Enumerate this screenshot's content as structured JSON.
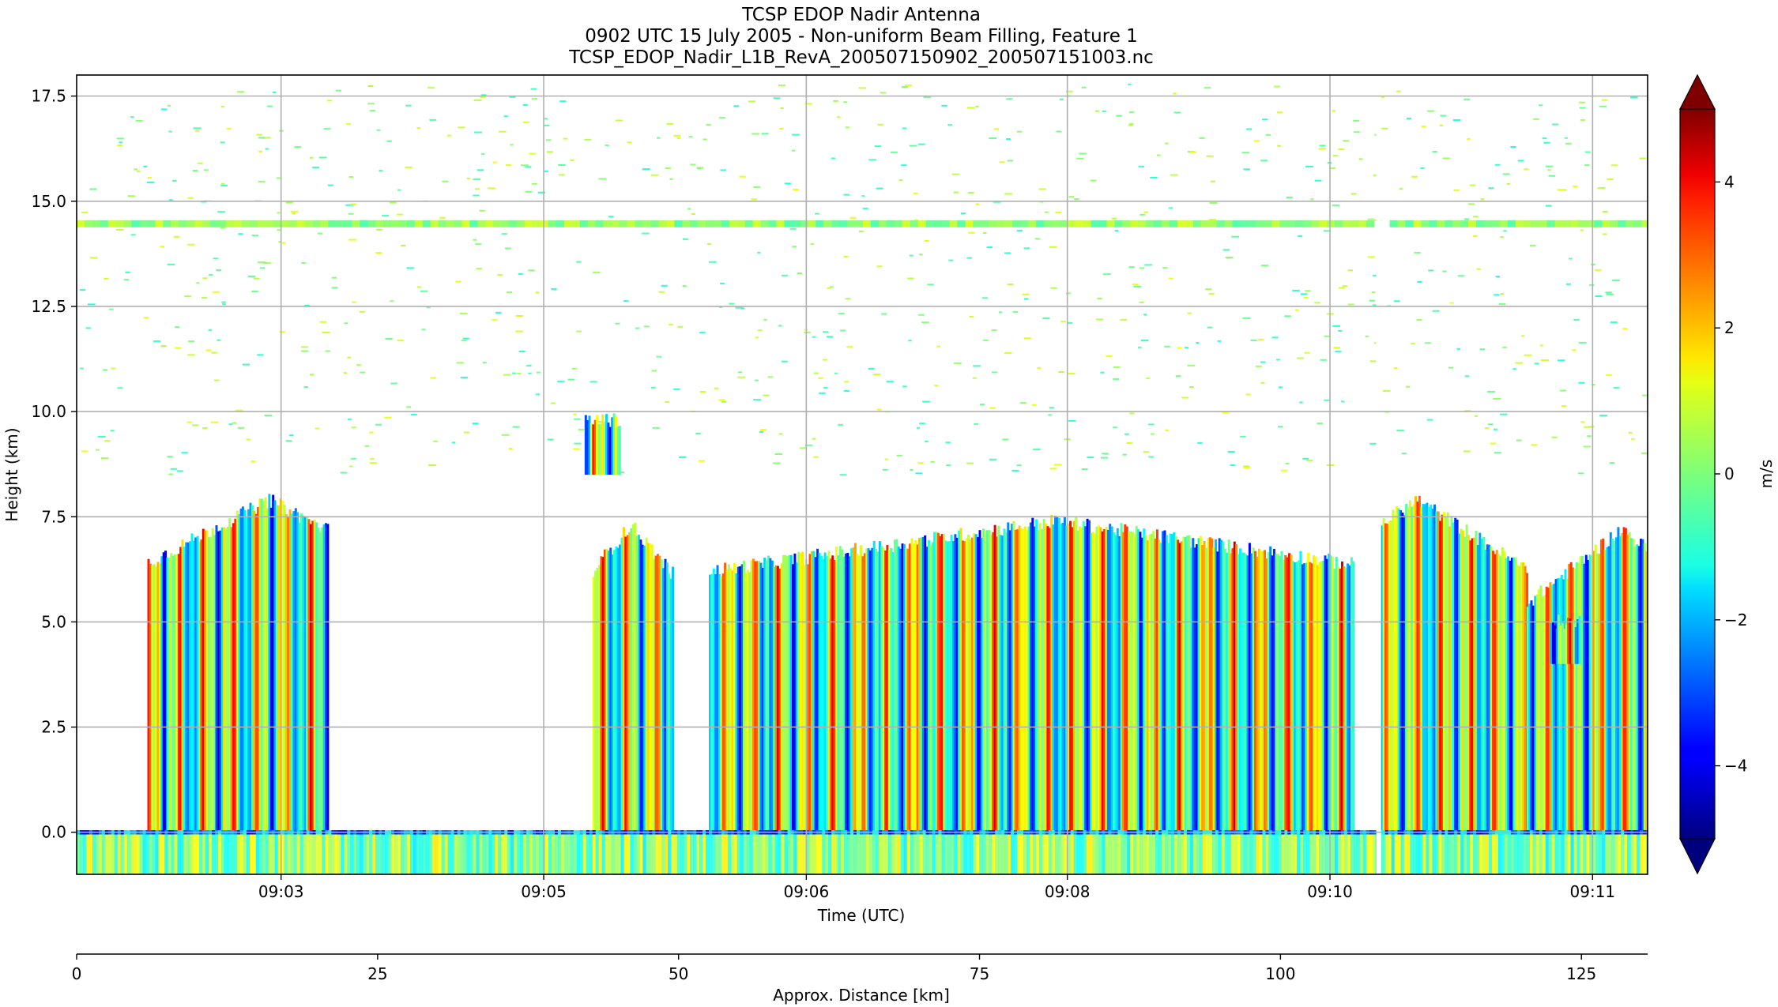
{
  "chart_data": {
    "type": "heatmap",
    "title_lines": [
      "TCSP EDOP Nadir Antenna",
      "0902 UTC 15 July 2005 - Non-uniform Beam Filling, Feature 1",
      "TCSP_EDOP_Nadir_L1B_RevA_200507150902_200507151003.nc"
    ],
    "xlabel": "Time (UTC)",
    "ylabel": "Height (km)",
    "x2label": "Approx. Distance [km]",
    "colorbar_label": "m/s",
    "colormap": "jet",
    "clim": [
      -5,
      5
    ],
    "colorbar_extend": "both",
    "ylim": [
      -1.0,
      18.0
    ],
    "xlim_minutes_after_0900": [
      1.78,
      11.77
    ],
    "yticks": [
      0.0,
      2.5,
      5.0,
      7.5,
      10.0,
      12.5,
      15.0,
      17.5
    ],
    "ytick_labels": [
      "0.0",
      "2.5",
      "5.0",
      "7.5",
      "10.0",
      "12.5",
      "15.0",
      "17.5"
    ],
    "xticks_minutes_after_0900": [
      3.08,
      4.75,
      6.42,
      8.08,
      9.75,
      11.42
    ],
    "xtick_labels": [
      "09:03",
      "09:05",
      "09:06",
      "09:08",
      "09:10",
      "09:11"
    ],
    "distance_ticks": [
      0,
      25,
      50,
      75,
      100,
      125
    ],
    "distance_tick_labels": [
      "0",
      "25",
      "50",
      "75",
      "100",
      "125"
    ],
    "distance_lim": [
      0,
      130.5
    ],
    "colorbar_ticks": [
      -4,
      -2,
      0,
      2,
      4
    ],
    "colorbar_tick_labels": [
      "−4",
      "−2",
      "0",
      "2",
      "4"
    ],
    "grid": true,
    "features": {
      "tropopause_band_km": 14.4,
      "surface_band_km": 0.0,
      "data_gap_minutes_after_0900": 10.06,
      "cloud_echoes": [
        {
          "start": 2.23,
          "end": 3.38,
          "top_km": 7.9,
          "peak_at": 3.0
        },
        {
          "start": 5.06,
          "end": 5.57,
          "top_km": 7.3,
          "peak_at": 5.3
        },
        {
          "start": 5.01,
          "end": 5.23,
          "top_km": 9.8,
          "base_km": 8.5,
          "elevated": true
        },
        {
          "start": 5.8,
          "end": 9.9,
          "top_km": 7.4,
          "peak_at": 8.0
        },
        {
          "start": 10.06,
          "end": 11.0,
          "top_km": 7.9,
          "peak_at": 10.3
        },
        {
          "start": 11.0,
          "end": 11.77,
          "top_km": 7.2,
          "peak_at": 11.6
        },
        {
          "start": 11.15,
          "end": 11.35,
          "top_km": 5.0,
          "base_km": 4.0,
          "elevated": true
        }
      ]
    }
  }
}
